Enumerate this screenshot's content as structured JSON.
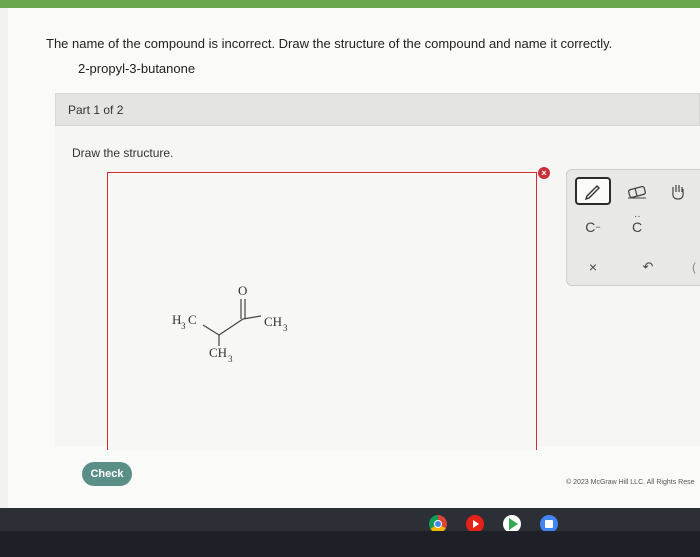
{
  "question": {
    "prompt": "The name of the compound is incorrect. Draw the structure of the compound and name it correctly.",
    "compound_name": "2-propyl-3-butanone"
  },
  "part": {
    "label": "Part 1 of 2"
  },
  "draw": {
    "instruction": "Draw the structure.",
    "structure_labels": {
      "oxygen": "O",
      "left_methyl": "H",
      "right_methyl": "CH",
      "branch_methyl": "CH",
      "subscript": "3",
      "carbon": "C"
    }
  },
  "toolbar": {
    "pencil_icon": "pencil-icon",
    "eraser_icon": "eraser-icon",
    "hand_icon": "hand-icon",
    "carbanion_label": "C",
    "carbene_label": "C",
    "x_label": "×",
    "undo_label": "↶",
    "more_label": "("
  },
  "actions": {
    "check_label": "Check",
    "close_glyph": "×"
  },
  "footer": {
    "copyright": "© 2023 McGraw Hill LLC. All Rights Rese"
  },
  "taskbar": {
    "icons": [
      "chrome-icon",
      "youtube-icon",
      "play-store-icon",
      "docs-icon"
    ]
  },
  "colors": {
    "accent_red": "#c9303a",
    "check_button": "#5a8f88",
    "top_stripe": "#6aa84f"
  }
}
